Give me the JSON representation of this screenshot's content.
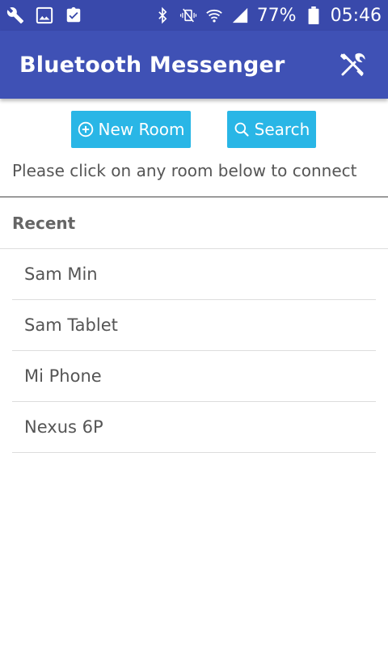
{
  "status_bar": {
    "left_icons": [
      "wrench-icon",
      "image-icon",
      "clipboard-check-icon"
    ],
    "right_icons": [
      "bluetooth-icon",
      "vibrate-mute-icon",
      "wifi-icon",
      "signal-icon"
    ],
    "battery": "77%",
    "time": "05:46"
  },
  "app_bar": {
    "title": "Bluetooth Messenger",
    "tools_icon": "tools-icon"
  },
  "actions": {
    "new_room_label": "New Room",
    "search_label": "Search"
  },
  "hint_text": "Please click on any room below to connect",
  "recent": {
    "header": "Recent",
    "rooms": [
      "Sam Min",
      "Sam Tablet",
      "Mi Phone",
      "Nexus 6P"
    ]
  },
  "colors": {
    "status_bar": "#3949ab",
    "app_bar": "#3f51b5",
    "button": "#29b6e6"
  }
}
